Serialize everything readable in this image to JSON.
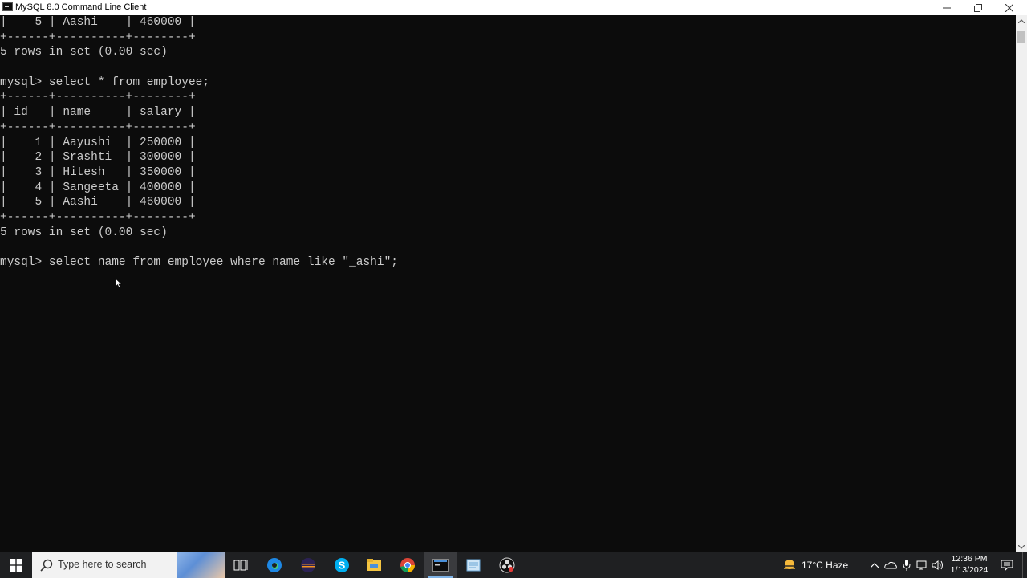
{
  "window": {
    "title": "MySQL 8.0 Command Line Client",
    "icon": "terminal-app-icon"
  },
  "console_lines": [
    "|    5 | Aashi    | 460000 |",
    "+------+----------+--------+",
    "5 rows in set (0.00 sec)",
    "",
    "mysql> select * from employee;",
    "+------+----------+--------+",
    "| id   | name     | salary |",
    "+------+----------+--------+",
    "|    1 | Aayushi  | 250000 |",
    "|    2 | Srashti  | 300000 |",
    "|    3 | Hitesh   | 350000 |",
    "|    4 | Sangeeta | 400000 |",
    "|    5 | Aashi    | 460000 |",
    "+------+----------+--------+",
    "5 rows in set (0.00 sec)",
    "",
    "mysql> select name from employee where name like \"_ashi\";"
  ],
  "taskbar": {
    "search_placeholder": "Type here to search",
    "apps": [
      {
        "name": "task-view-icon"
      },
      {
        "name": "edge-icon"
      },
      {
        "name": "eclipse-icon"
      },
      {
        "name": "skype-icon"
      },
      {
        "name": "file-explorer-icon"
      },
      {
        "name": "chrome-icon"
      },
      {
        "name": "mysql-terminal-icon",
        "active": true
      },
      {
        "name": "notepad-icon"
      },
      {
        "name": "obs-icon"
      }
    ],
    "weather": "17°C  Haze",
    "time": "12:36 PM",
    "date": "1/13/2024"
  },
  "colors": {
    "console_bg": "#0c0c0c",
    "console_text": "#cccccc",
    "taskbar_bg": "#1f2022"
  }
}
